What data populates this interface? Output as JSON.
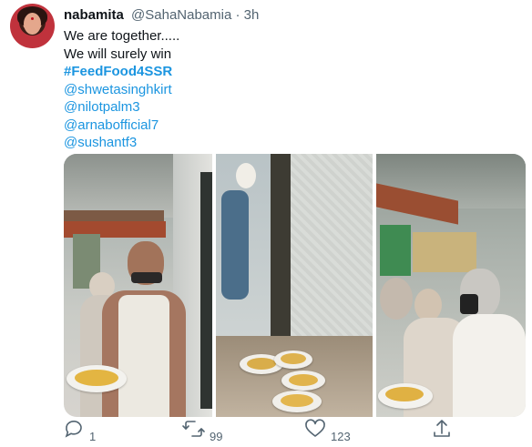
{
  "tweet": {
    "author_name": "nabamita",
    "author_handle": "@SahaNabamia",
    "separator": "·",
    "time": "3h",
    "lines": [
      "We are together.....",
      "We will surely win",
      "#FeedFood4SSR",
      "@shwetasinghkirt",
      "@nilotpalm3",
      "@arnabofficial7",
      "@sushantf3"
    ]
  },
  "actions": {
    "reply_count": "1",
    "retweet_count": "99",
    "like_count": "123"
  },
  "media": {
    "photo_count": 3
  },
  "icons": [
    "reply-icon",
    "retweet-icon",
    "like-icon",
    "share-icon"
  ],
  "colors": {
    "link": "#1b95e0",
    "muted": "#536471",
    "text": "#0f1419"
  }
}
